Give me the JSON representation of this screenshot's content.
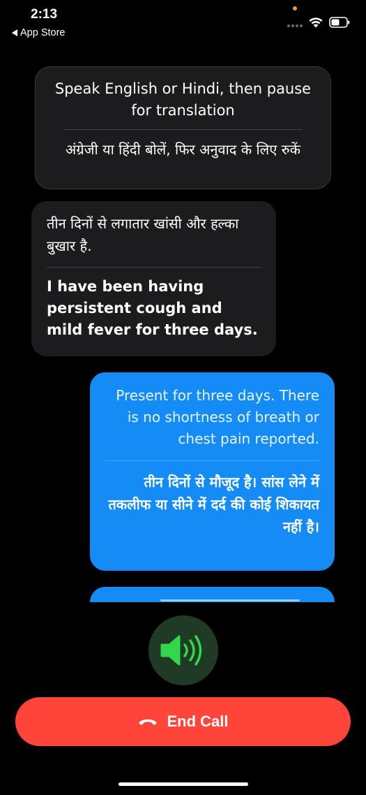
{
  "status_bar": {
    "time": "2:13",
    "back_label": "App Store"
  },
  "instruction": {
    "english": "Speak English or Hindi, then pause for translation",
    "hindi": "अंग्रेजी या हिंदी बोलें, फिर अनुवाद के लिए रुकें"
  },
  "messages": [
    {
      "direction": "incoming",
      "original": "तीन दिनों से लगातार खांसी और हल्का बुखार है.",
      "translation": "I have been having persistent cough and mild fever for three days."
    },
    {
      "direction": "outgoing",
      "original": "Present for three days. There is no shortness of breath or chest pain reported.",
      "translation": "तीन दिनों से मौजूद है। सांस लेने में तकलीफ या सीने में दर्द की कोई शिकायत नहीं है।"
    }
  ],
  "controls": {
    "speaker_icon": "speaker-wave-icon",
    "end_call_label": "End Call",
    "end_call_icon": "phone-hangup-icon"
  },
  "colors": {
    "background": "#000000",
    "incoming_bubble": "#1c1c1e",
    "outgoing_bubble": "#148bf5",
    "speaker_accent": "#32d74b",
    "end_call": "#ff453a"
  }
}
